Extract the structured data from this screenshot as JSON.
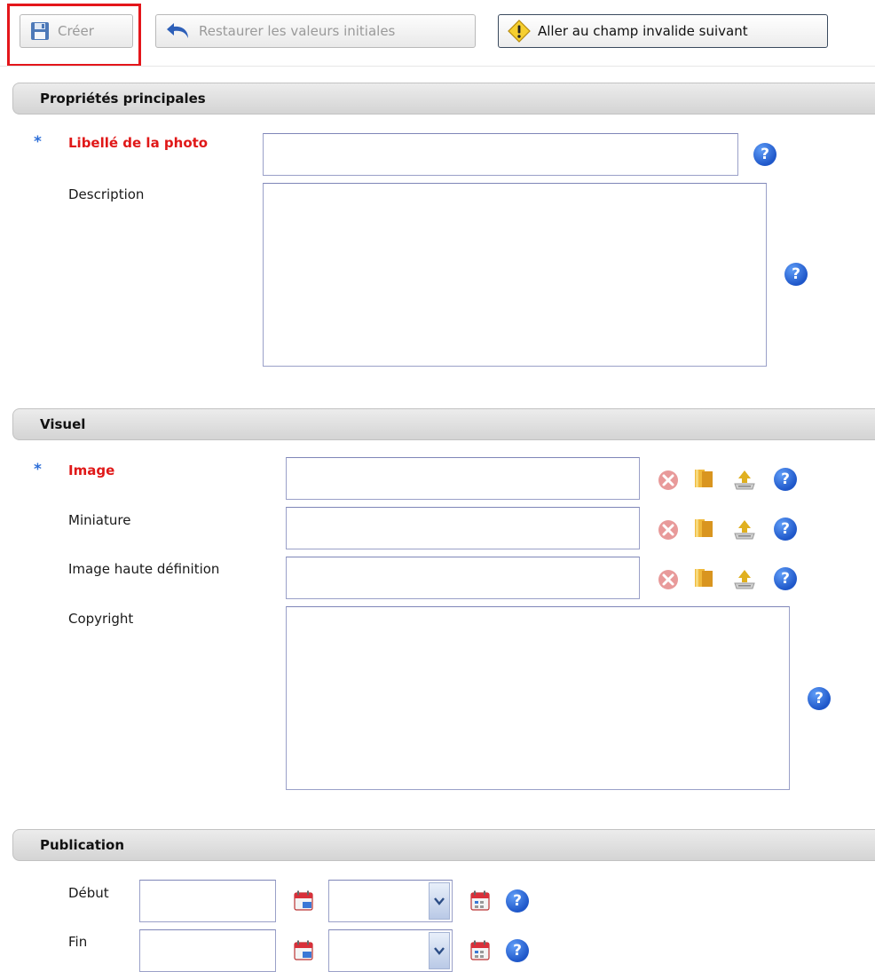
{
  "toolbar": {
    "create_label": "Créer",
    "restore_label": "Restaurer les valeurs initiales",
    "next_invalid_label": "Aller au champ invalide suivant"
  },
  "sections": {
    "main": {
      "title": "Propriétés principales",
      "photo_label": "Libellé de la photo",
      "description_label": "Description"
    },
    "visual": {
      "title": "Visuel",
      "image_label": "Image",
      "thumbnail_label": "Miniature",
      "hd_image_label": "Image haute définition",
      "copyright_label": "Copyright"
    },
    "publication": {
      "title": "Publication",
      "start_label": "Début",
      "end_label": "Fin"
    }
  },
  "required_marker": "*",
  "help_glyph": "?",
  "colors": {
    "required": "#e01818",
    "help_blue": "#1f57c9",
    "highlight": "#e4161b"
  }
}
